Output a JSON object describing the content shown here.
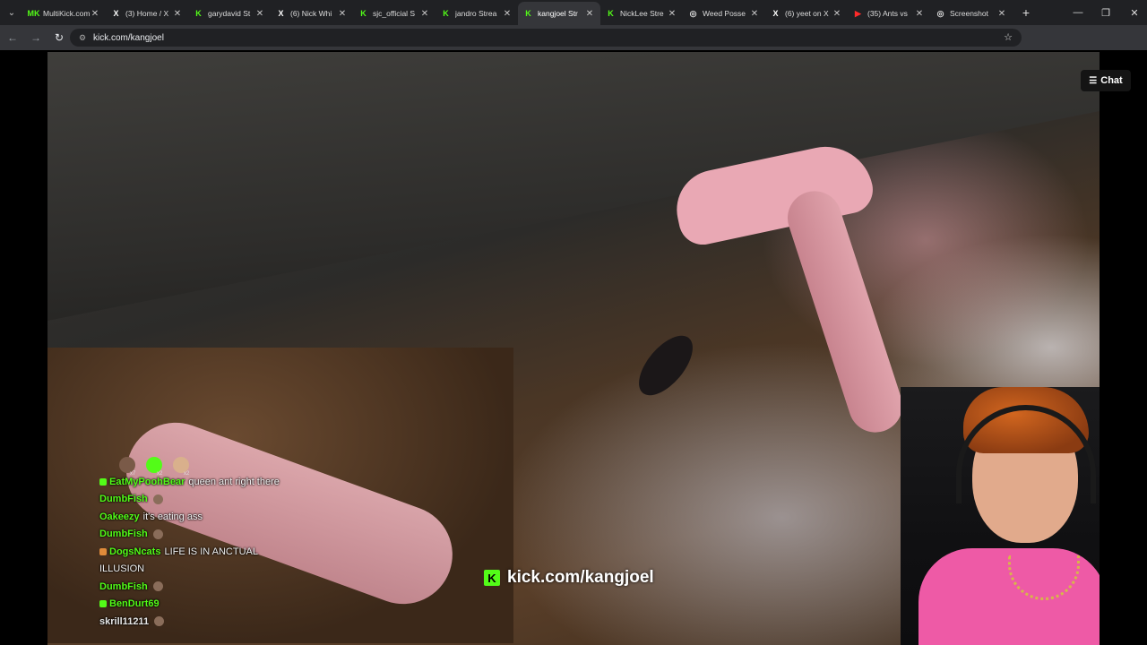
{
  "tabs": [
    {
      "title": "MultiKick.com",
      "favicon": "MK",
      "favicon_color": "#53fc18",
      "active": false
    },
    {
      "title": "(3) Home / X",
      "favicon": "X",
      "favicon_color": "#ffffff",
      "active": false
    },
    {
      "title": "garydavid St",
      "favicon": "K",
      "favicon_color": "#53fc18",
      "active": false
    },
    {
      "title": "(6) Nick Whi",
      "favicon": "X",
      "favicon_color": "#ffffff",
      "active": false
    },
    {
      "title": "sjc_official S",
      "favicon": "K",
      "favicon_color": "#53fc18",
      "active": false
    },
    {
      "title": "jandro Strea",
      "favicon": "K",
      "favicon_color": "#53fc18",
      "active": false
    },
    {
      "title": "kangjoel Str",
      "favicon": "K",
      "favicon_color": "#53fc18",
      "active": true
    },
    {
      "title": "NickLee Stre",
      "favicon": "K",
      "favicon_color": "#53fc18",
      "active": false
    },
    {
      "title": "Weed Posse",
      "favicon": "◎",
      "favicon_color": "#dddddd",
      "active": false
    },
    {
      "title": "(6) yeet on X",
      "favicon": "X",
      "favicon_color": "#ffffff",
      "active": false
    },
    {
      "title": "(35) Ants vs",
      "favicon": "▶",
      "favicon_color": "#ff2a2a",
      "active": false
    },
    {
      "title": "Screenshot",
      "favicon": "◎",
      "favicon_color": "#dddddd",
      "active": false
    }
  ],
  "omnibox": {
    "url": "kick.com/kangjoel"
  },
  "chat_button": {
    "label": "Chat"
  },
  "overlay_chat": {
    "messages": [
      {
        "user": "EatMyPoohBear",
        "user_color": "#53fc18",
        "text": "queen ant right there",
        "badge_color": "#53fc18",
        "emote": false
      },
      {
        "user": "DumbFish",
        "user_color": "#53fc18",
        "text": "",
        "badge_color": "",
        "emote": true
      },
      {
        "user": "Oakeezy",
        "user_color": "#53fc18",
        "text": "it's eating ass",
        "badge_color": "",
        "emote": false
      },
      {
        "user": "DumbFish",
        "user_color": "#53fc18",
        "text": "",
        "badge_color": "",
        "emote": true
      },
      {
        "user": "DogsNcats",
        "user_color": "#53fc18",
        "text": "LIFE IS IN ANCTUAL",
        "badge_color": "#e08b3a",
        "emote": false
      },
      {
        "user": "",
        "user_color": "#53fc18",
        "text": "ILLUSION",
        "badge_color": "",
        "emote": false
      },
      {
        "user": "DumbFish",
        "user_color": "#53fc18",
        "text": "",
        "badge_color": "",
        "emote": true
      },
      {
        "user": "BenDurt69",
        "user_color": "#53fc18",
        "text": "",
        "badge_color": "#53fc18",
        "emote": false
      },
      {
        "user": "skrill11211",
        "user_color": "#e6e6e6",
        "text": "",
        "badge_color": "",
        "emote": true
      }
    ],
    "emote_counts": [
      "x7",
      "x2",
      "x2"
    ]
  },
  "watermark": {
    "text": "kick.com/kangjoel",
    "logo": "K"
  },
  "colors": {
    "kick_green": "#53fc18",
    "tab_bg": "#202124",
    "toolbar_bg": "#35363a"
  }
}
